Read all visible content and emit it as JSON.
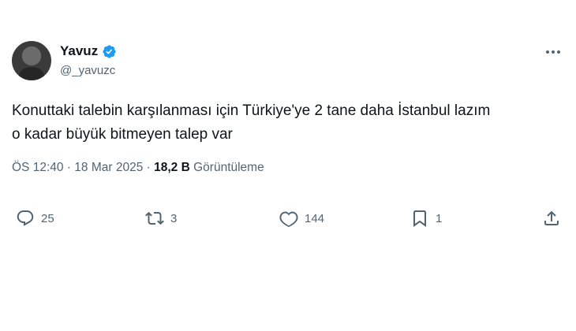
{
  "author": {
    "display_name": "Yavuz",
    "handle": "@_yavuzc",
    "verified": true
  },
  "tweet": {
    "text_lines": [
      "Konuttaki talebin karşılanması için Türkiye'ye 2 tane daha İstanbul lazım",
      "o kadar büyük bitmeyen talep var"
    ]
  },
  "meta": {
    "time": "ÖS 12:40",
    "separator": "·",
    "date": "18 Mar 2025",
    "views_count": "18,2 B",
    "views_label": "Görüntüleme"
  },
  "actions": {
    "reply_count": "25",
    "retweet_count": "3",
    "like_count": "144",
    "bookmark_count": "1"
  },
  "colors": {
    "text_primary": "#0f1419",
    "text_secondary": "#536471",
    "verified_blue": "#1d9bf0"
  }
}
